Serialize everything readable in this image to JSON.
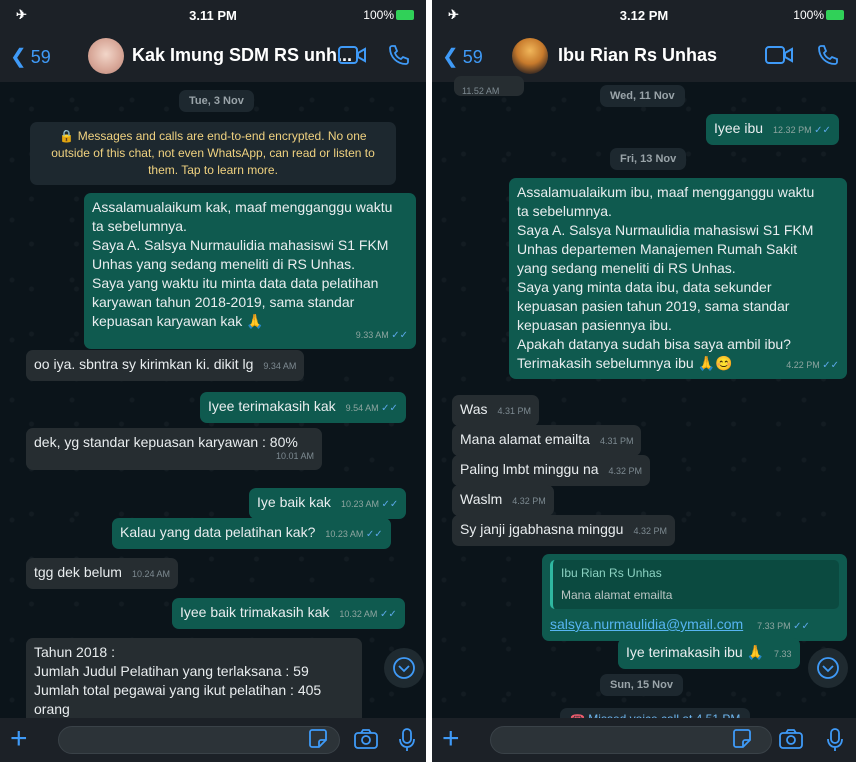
{
  "left": {
    "status": {
      "time": "3.11 PM",
      "battery": "100%"
    },
    "header": {
      "back_count": "59",
      "title": "Kak Imung SDM RS unh..."
    },
    "date_chip": "Tue, 3 Nov",
    "encryption_notice": "Messages and calls are end-to-end encrypted. No one outside of this chat, not even WhatsApp, can read or listen to them. Tap to learn more.",
    "messages": [
      {
        "dir": "out",
        "lines": [
          "Assalamualaikum kak, maaf mengganggu waktu",
          "ta sebelumnya.",
          "Saya A. Salsya Nurmaulidia mahasiswi S1 FKM",
          "Unhas yang sedang meneliti di RS Unhas.",
          "Saya yang waktu itu minta data data pelatihan",
          "karyawan tahun 2018-2019, sama standar",
          "kepuasan karyawan kak 🙏"
        ],
        "time": "9.33 AM"
      },
      {
        "dir": "in",
        "text": "oo iya. sbntra sy kirimkan ki. dikit lg",
        "time": "9.34 AM"
      },
      {
        "dir": "out",
        "text": "Iyee terimakasih kak",
        "time": "9.54 AM"
      },
      {
        "dir": "in",
        "text": "dek, yg standar kepuasan karyawan : 80%",
        "time": "10.01 AM"
      },
      {
        "dir": "out",
        "text": "Iye baik kak",
        "time": "10.23 AM"
      },
      {
        "dir": "out",
        "text": "Kalau yang data pelatihan kak?",
        "time": "10.23 AM"
      },
      {
        "dir": "in",
        "text": "tgg dek belum",
        "time": "10.24 AM"
      },
      {
        "dir": "out",
        "text": "Iyee baik trimakasih kak",
        "time": "10.32 AM"
      },
      {
        "dir": "in",
        "lines": [
          "Tahun 2018 :",
          "Jumlah Judul Pelatihan yang terlaksana : 59",
          "Jumlah total pegawai yang ikut pelatihan : 405",
          "orang"
        ]
      }
    ]
  },
  "right": {
    "status": {
      "time": "3.12 PM",
      "battery": "100%"
    },
    "header": {
      "back_count": "59",
      "title": "Ibu Rian Rs Unhas"
    },
    "top_partial_time": "11.52 AM",
    "date_chip_1": "Wed, 11 Nov",
    "date_chip_2": "Fri, 13 Nov",
    "date_chip_3": "Sun, 15 Nov",
    "messages": [
      {
        "dir": "out",
        "text": "Iyee ibu",
        "time": "12.32 PM"
      },
      {
        "dir": "out",
        "lines": [
          "Assalamualaikum ibu, maaf mengganggu waktu",
          "ta sebelumnya.",
          "Saya A. Salsya Nurmaulidia mahasiswi S1 FKM",
          "Unhas departemen Manajemen Rumah Sakit",
          "yang sedang meneliti di RS Unhas.",
          "Saya yang minta data ibu, data sekunder",
          "kepuasan pasien tahun 2019, sama standar",
          "kepuasan pasiennya ibu.",
          "Apakah datanya sudah bisa saya ambil ibu?",
          "Terimakasih sebelumnya ibu 🙏😊"
        ],
        "time": "4.22 PM"
      },
      {
        "dir": "in",
        "text": "Was",
        "time": "4.31 PM"
      },
      {
        "dir": "in",
        "text": "Mana alamat emailta",
        "time": "4.31 PM"
      },
      {
        "dir": "in",
        "text": "Paling lmbt minggu na",
        "time": "4.32 PM"
      },
      {
        "dir": "in",
        "text": "Waslm",
        "time": "4.32 PM"
      },
      {
        "dir": "in",
        "text": "Sy janji jgabhasna minggu",
        "time": "4.32 PM"
      },
      {
        "dir": "out",
        "quote_name": "Ibu Rian Rs Unhas",
        "quote_text": "Mana alamat emailta",
        "link": "salsya.nurmaulidia@ymail.com",
        "time": "7.33 PM"
      },
      {
        "dir": "out",
        "text": "Iye terimakasih ibu 🙏",
        "time": "7.33"
      }
    ],
    "missed_call": "Missed voice call at 4.51 PM"
  },
  "colors": {
    "accent": "#3f9af7",
    "outgoing": "#0f5a4f",
    "incoming": "#262d31",
    "read_tick": "#5ba7e8"
  },
  "icons": [
    "back-chevron-icon",
    "video-call-icon",
    "voice-call-icon",
    "plus-icon",
    "sticker-icon",
    "camera-icon",
    "mic-icon",
    "scroll-down-icon",
    "lock-icon",
    "missed-call-icon",
    "airplane-mode-icon"
  ]
}
